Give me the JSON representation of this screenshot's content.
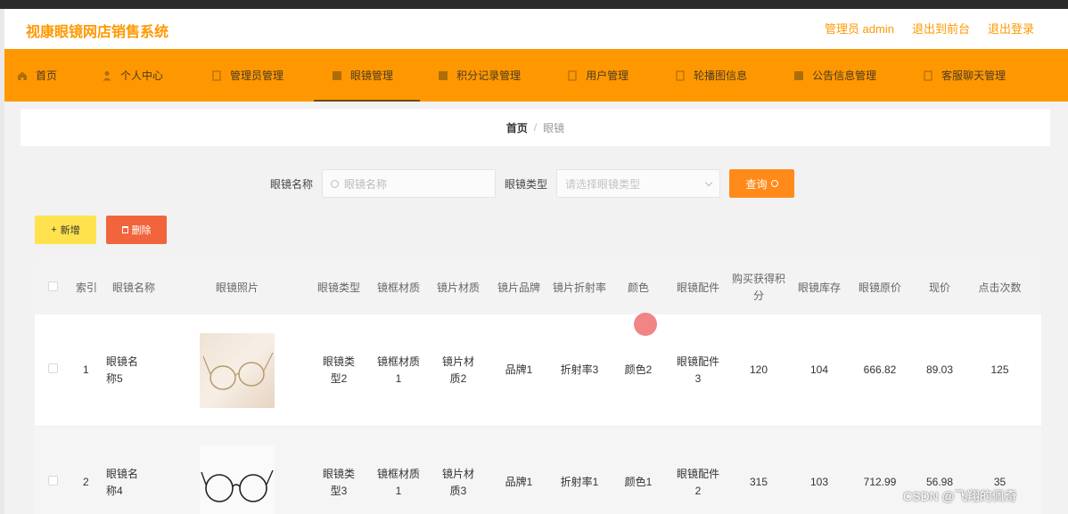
{
  "app": {
    "title": "视康眼镜网店销售系统",
    "admin_label": "管理员 admin",
    "back_frontend": "退出到前台",
    "logout": "退出登录"
  },
  "nav": [
    {
      "label": "首页",
      "icon": "home-icon"
    },
    {
      "label": "个人中心",
      "icon": "user-icon"
    },
    {
      "label": "管理员管理",
      "icon": "document-icon"
    },
    {
      "label": "眼镜管理",
      "icon": "grid-icon",
      "active": true
    },
    {
      "label": "积分记录管理",
      "icon": "grid-icon"
    },
    {
      "label": "用户管理",
      "icon": "document-icon"
    },
    {
      "label": "轮播图信息",
      "icon": "document-icon"
    },
    {
      "label": "公告信息管理",
      "icon": "grid-icon"
    },
    {
      "label": "客服聊天管理",
      "icon": "document-icon"
    }
  ],
  "breadcrumb": {
    "home": "首页",
    "separator": "/",
    "current": "眼镜"
  },
  "search": {
    "name_label": "眼镜名称",
    "name_placeholder": "眼镜名称",
    "type_label": "眼镜类型",
    "type_placeholder": "请选择眼镜类型",
    "query_label": "查询"
  },
  "actions": {
    "add_label": "新增",
    "delete_label": "删除"
  },
  "table": {
    "columns": [
      "索引",
      "眼镜名称",
      "眼镜照片",
      "眼镜类型",
      "镜框材质",
      "镜片材质",
      "镜片品牌",
      "镜片折射率",
      "颜色",
      "眼镜配件",
      "购买获得积分",
      "眼镜库存",
      "眼镜原价",
      "现价",
      "点击次数"
    ],
    "rows": [
      {
        "index": "1",
        "name": "眼镜名称5",
        "photo": "glasses-photo-gold",
        "type": "眼镜类型2",
        "frame": "镜框材质1",
        "lens": "镜片材质2",
        "brand": "品牌1",
        "refraction": "折射率3",
        "color": "颜色2",
        "accessory": "眼镜配件3",
        "points": "120",
        "stock": "104",
        "orig_price": "666.82",
        "price": "89.03",
        "clicks": "125"
      },
      {
        "index": "2",
        "name": "眼镜名称4",
        "photo": "glasses-photo-black",
        "type": "眼镜类型3",
        "frame": "镜框材质1",
        "lens": "镜片材质3",
        "brand": "品牌1",
        "refraction": "折射率1",
        "color": "颜色1",
        "accessory": "眼镜配件2",
        "points": "315",
        "stock": "103",
        "orig_price": "712.99",
        "price": "56.98",
        "clicks": "35"
      }
    ]
  },
  "watermark": "CSDN @飞翔的佩奇",
  "colors": {
    "accent": "#ff9800",
    "query": "#ff8a1a",
    "add": "#ffe24d",
    "delete": "#f2643c"
  }
}
